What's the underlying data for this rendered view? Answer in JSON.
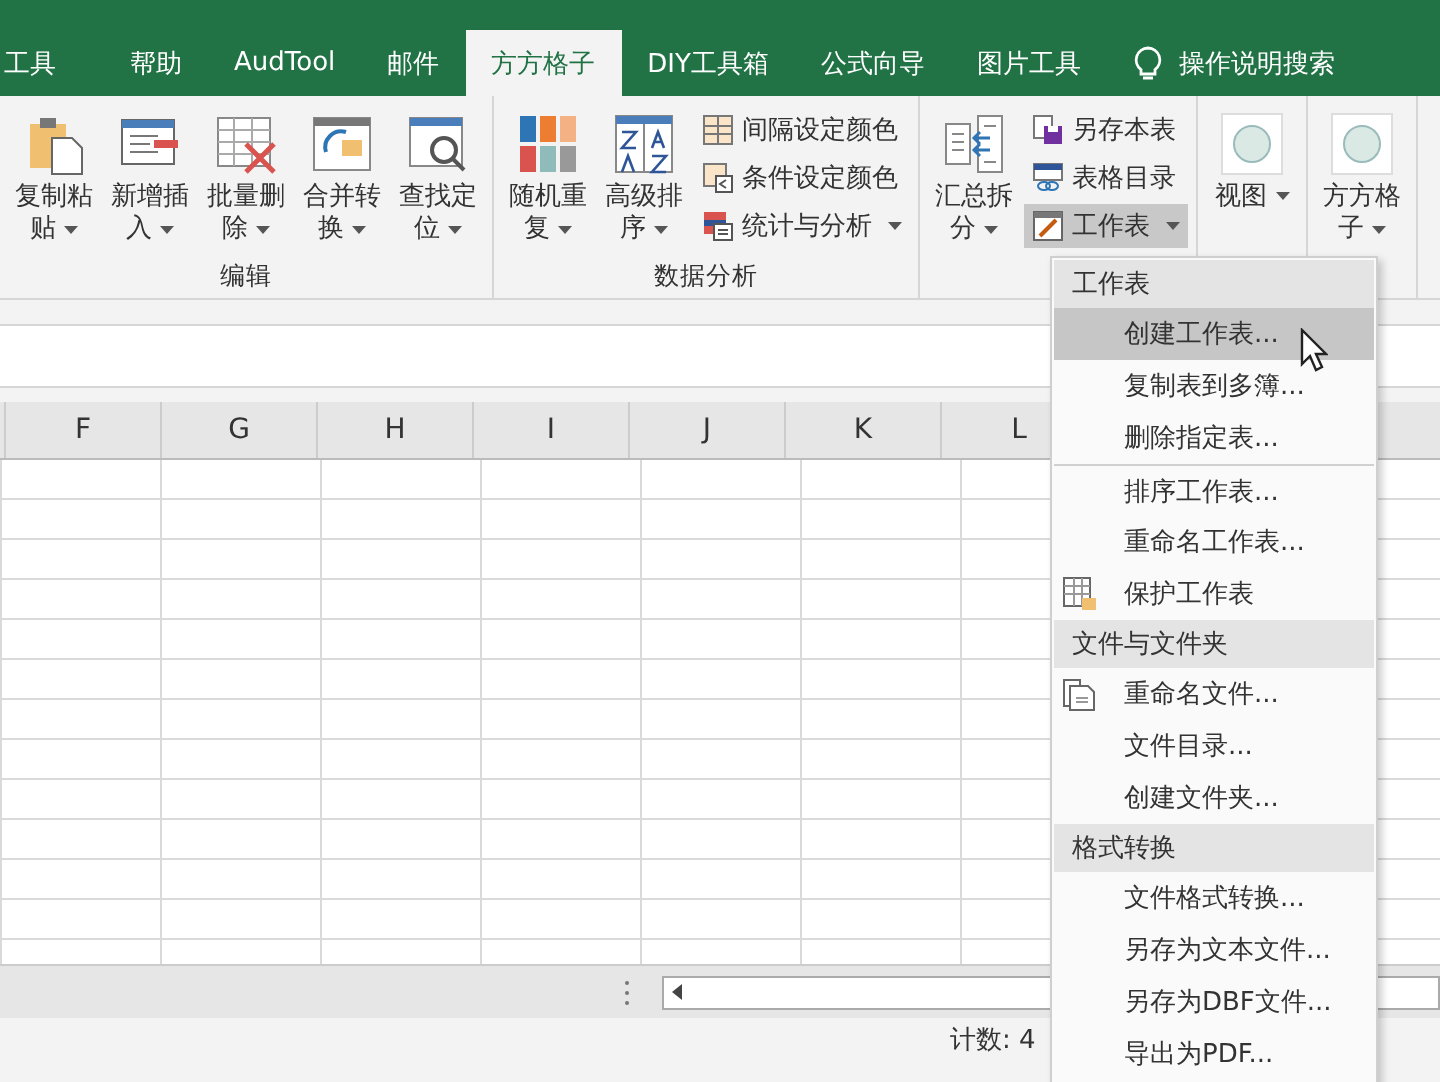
{
  "tabs": [
    {
      "label": "工具",
      "selected": false
    },
    {
      "label": "帮助",
      "selected": false
    },
    {
      "label": "AudTool",
      "selected": false
    },
    {
      "label": "邮件",
      "selected": false
    },
    {
      "label": "方方格子",
      "selected": true
    },
    {
      "label": "DIY工具箱",
      "selected": false
    },
    {
      "label": "公式向导",
      "selected": false
    },
    {
      "label": "图片工具",
      "selected": false
    }
  ],
  "search": {
    "label": "操作说明搜索"
  },
  "ribbon": {
    "groups": [
      {
        "title": "编辑",
        "large": [
          {
            "label": "复制粘贴"
          },
          {
            "label": "新增插入"
          },
          {
            "label": "批量删除"
          },
          {
            "label": "合并转换"
          },
          {
            "label": "查找定位"
          }
        ]
      },
      {
        "title": "数据分析",
        "large": [
          {
            "label": "随机重复"
          },
          {
            "label": "高级排序"
          }
        ],
        "small": [
          {
            "label": "间隔设定颜色",
            "dropdown": false,
            "pressed": false
          },
          {
            "label": "条件设定颜色",
            "dropdown": false,
            "pressed": false
          },
          {
            "label": "统计与分析",
            "dropdown": true,
            "pressed": false
          }
        ]
      },
      {
        "large": [
          {
            "label": "汇总拆分"
          }
        ],
        "small": [
          {
            "label": "另存本表",
            "dropdown": false,
            "pressed": false
          },
          {
            "label": "表格目录",
            "dropdown": false,
            "pressed": false
          },
          {
            "label": "工作表",
            "dropdown": true,
            "pressed": true
          }
        ]
      },
      {
        "large": [
          {
            "label": "视图"
          }
        ]
      },
      {
        "large": [
          {
            "label": "方方格子"
          }
        ]
      }
    ]
  },
  "columns": [
    "F",
    "G",
    "H",
    "I",
    "J",
    "K",
    "L"
  ],
  "menu": [
    {
      "kind": "header",
      "label": "工作表"
    },
    {
      "kind": "item",
      "label": "创建工作表...",
      "selected": true,
      "separator": false
    },
    {
      "kind": "item",
      "label": "复制表到多簿...",
      "selected": false,
      "separator": false
    },
    {
      "kind": "item",
      "label": "删除指定表...",
      "selected": false,
      "separator": false
    },
    {
      "kind": "item",
      "label": "排序工作表...",
      "selected": false,
      "separator": true
    },
    {
      "kind": "item",
      "label": "重命名工作表...",
      "selected": false,
      "separator": false
    },
    {
      "kind": "item",
      "label": "保护工作表",
      "selected": false,
      "separator": false
    },
    {
      "kind": "header",
      "label": "文件与文件夹"
    },
    {
      "kind": "item",
      "label": "重命名文件...",
      "selected": false,
      "separator": false
    },
    {
      "kind": "item",
      "label": "文件目录...",
      "selected": false,
      "separator": false
    },
    {
      "kind": "item",
      "label": "创建文件夹...",
      "selected": false,
      "separator": false
    },
    {
      "kind": "header",
      "label": "格式转换"
    },
    {
      "kind": "item",
      "label": "文件格式转换...",
      "selected": false,
      "separator": false
    },
    {
      "kind": "item",
      "label": "另存为文本文件...",
      "selected": false,
      "separator": false
    },
    {
      "kind": "item",
      "label": "另存为DBF文件...",
      "selected": false,
      "separator": false
    },
    {
      "kind": "item",
      "label": "导出为PDF...",
      "selected": false,
      "separator": false
    }
  ],
  "status_bar": {
    "count": "计数: 4"
  }
}
